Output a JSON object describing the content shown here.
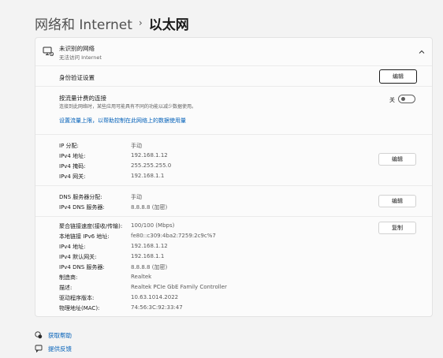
{
  "breadcrumb": {
    "parent": "网络和 Internet",
    "separator": "›",
    "current": "以太网"
  },
  "network": {
    "name": "未识别的网络",
    "status": "无法访问 Internet"
  },
  "auth": {
    "label": "身份验证设置",
    "button": "编辑"
  },
  "metered": {
    "title": "按流量计费的连接",
    "description": "连接到此网络时，某些应用可能具有不同的功能以减少数据使用。",
    "toggle_label": "关",
    "toggle_on": false,
    "link": "设置流量上限，以帮助控制在此网络上的数据使用量"
  },
  "ip": {
    "button": "编辑",
    "rows": [
      {
        "key": "IP 分配:",
        "value": "手动"
      },
      {
        "key": "IPv4 地址:",
        "value": "192.168.1.12"
      },
      {
        "key": "IPv4 掩码:",
        "value": "255.255.255.0"
      },
      {
        "key": "IPv4 网关:",
        "value": "192.168.1.1"
      }
    ]
  },
  "dns": {
    "button": "编辑",
    "rows": [
      {
        "key": "DNS 服务器分配:",
        "value": "手动"
      },
      {
        "key": "IPv4 DNS 服务器:",
        "value": "8.8.8.8 (加密)"
      }
    ]
  },
  "properties": {
    "button": "复制",
    "rows": [
      {
        "key": "聚合链接速度(接收/传输):",
        "value": "100/100 (Mbps)"
      },
      {
        "key": "本地链接 IPv6 地址:",
        "value": "fe80::c309:4ba2:7259:2c9c%7"
      },
      {
        "key": "IPv4 地址:",
        "value": "192.168.1.12"
      },
      {
        "key": "IPv4 默认网关:",
        "value": "192.168.1.1"
      },
      {
        "key": "IPv4 DNS 服务器:",
        "value": "8.8.8.8 (加密)"
      },
      {
        "key": "制造商:",
        "value": "Realtek"
      },
      {
        "key": "描述:",
        "value": "Realtek PCIe GbE Family Controller"
      },
      {
        "key": "驱动程序版本:",
        "value": "10.63.1014.2022"
      },
      {
        "key": "物理地址(MAC):",
        "value": "74:56:3C:92:33:47"
      }
    ]
  },
  "footer": {
    "help": "获取帮助",
    "feedback": "提供反馈"
  },
  "colors": {
    "link": "#005fb8",
    "background": "#f3f3f3",
    "card": "#fbfbfb"
  }
}
